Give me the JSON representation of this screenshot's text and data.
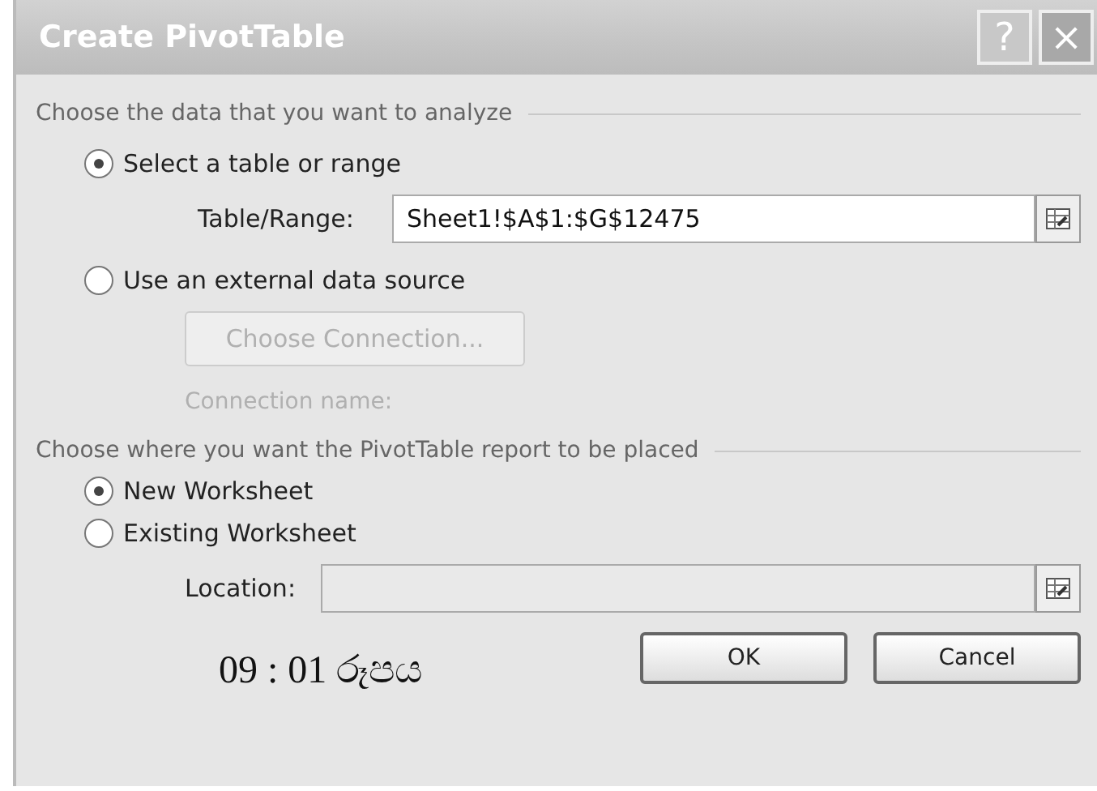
{
  "window": {
    "title": "Create PivotTable",
    "controls": [
      {
        "kind": "help",
        "label": "?"
      },
      {
        "kind": "close",
        "label": "×"
      }
    ]
  },
  "source_section": {
    "heading": "Choose the data that you want to analyze",
    "options": [
      {
        "label": "Select a table or range",
        "selected": true
      },
      {
        "label": "Use an external data source",
        "selected": false
      }
    ],
    "range_field": {
      "label": "Table/Range:",
      "value": "Sheet1!$A$1:$G$12475",
      "disabled": false
    },
    "connection_button": {
      "label": "Choose Connection...",
      "disabled": true
    },
    "connection_name": {
      "label": "Connection name:",
      "disabled": true
    }
  },
  "destination_section": {
    "heading": "Choose where you want the PivotTable report to be placed",
    "options": [
      {
        "label": "New Worksheet",
        "selected": true
      },
      {
        "label": "Existing Worksheet",
        "selected": false
      }
    ],
    "location_field": {
      "label": "Location:",
      "disabled": true
    }
  },
  "buttons": [
    {
      "label": "OK"
    },
    {
      "label": "Cancel"
    }
  ],
  "caption": "09 : 01 රූපය"
}
